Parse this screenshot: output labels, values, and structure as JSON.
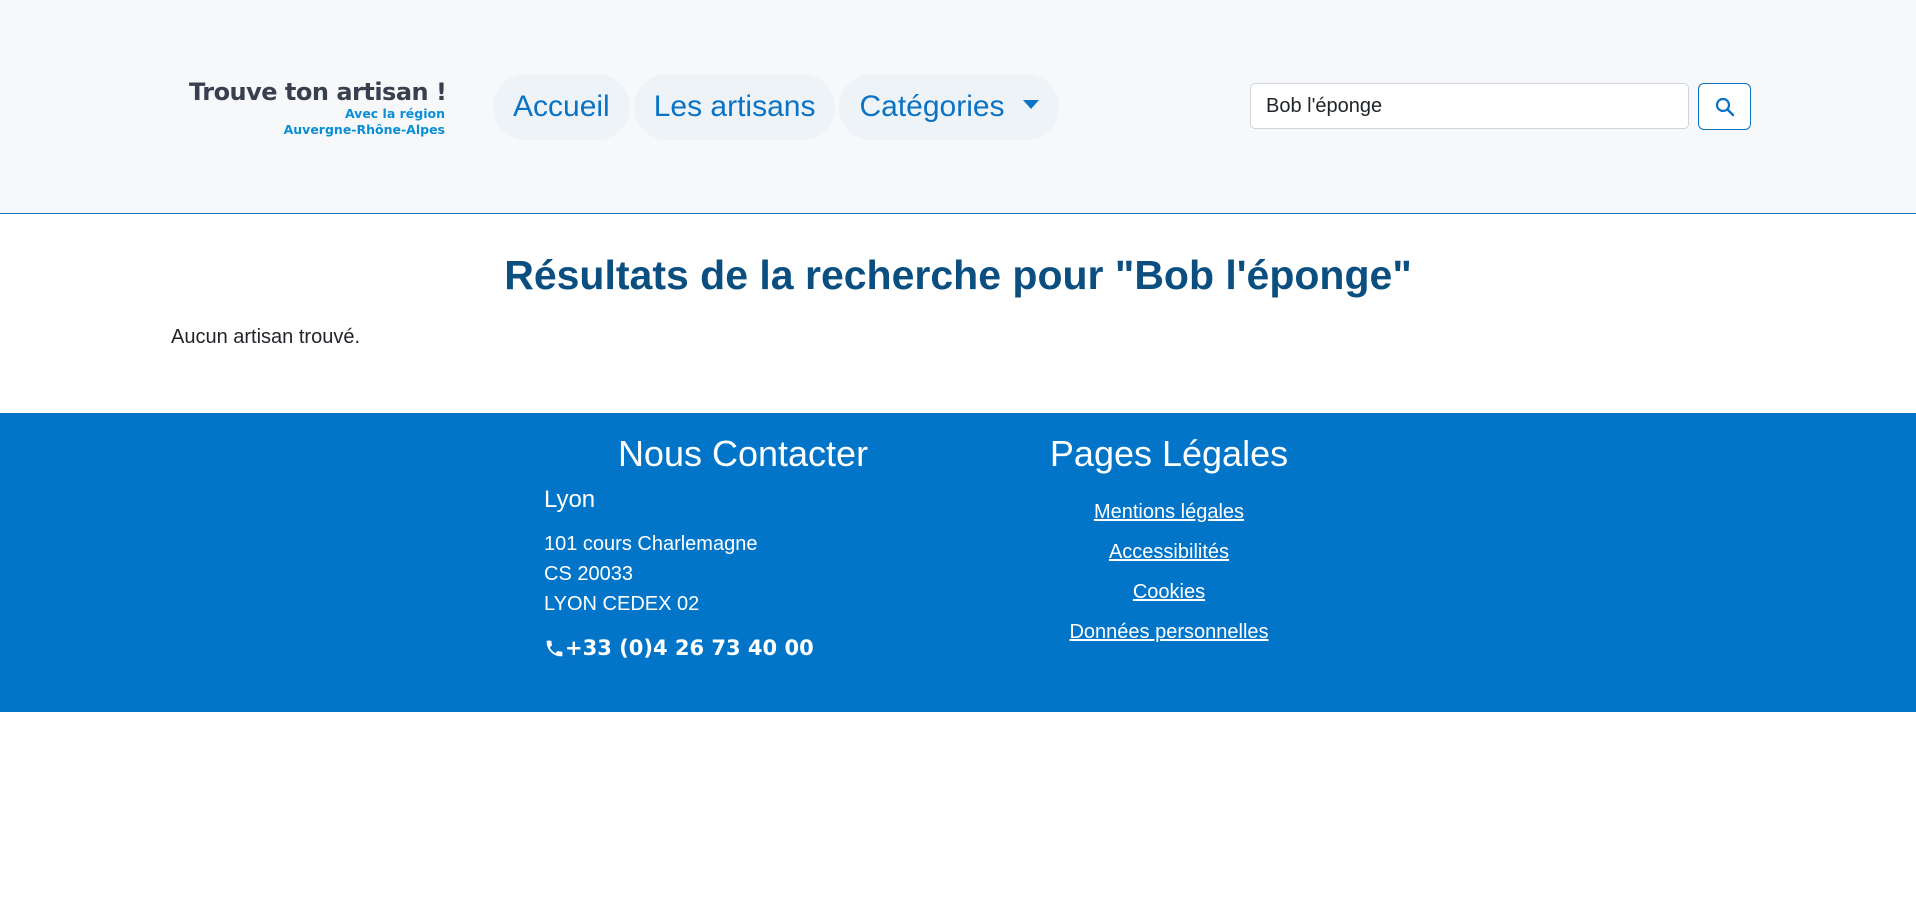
{
  "header": {
    "logo": {
      "title": "Trouve ton artisan !",
      "subtitle_line1": "Avec la région",
      "subtitle_line2": "Auvergne-Rhône-Alpes"
    },
    "nav": {
      "home": "Accueil",
      "artisans": "Les artisans",
      "categories": "Catégories"
    },
    "search": {
      "value": "Bob l'éponge",
      "button_icon": "search-icon"
    }
  },
  "main": {
    "results_title": "Résultats de la recherche pour \"Bob l'éponge\"",
    "no_results": "Aucun artisan trouvé."
  },
  "footer": {
    "contact": {
      "title": "Nous Contacter",
      "city": "Lyon",
      "address_line1": "101 cours Charlemagne",
      "address_line2": "CS 20033",
      "address_line3": "LYON CEDEX 02",
      "phone": "+33 (0)4 26 73 40 00",
      "phone_icon": "phone-icon"
    },
    "legal": {
      "title": "Pages Légales",
      "links": [
        "Mentions légales",
        "Accessibilités",
        "Cookies",
        "Données personnelles"
      ]
    }
  },
  "colors": {
    "header_bg": "#f6f8fa",
    "primary": "#0a73c4",
    "title": "#0b4f80",
    "footer_bg": "#0275c9"
  }
}
